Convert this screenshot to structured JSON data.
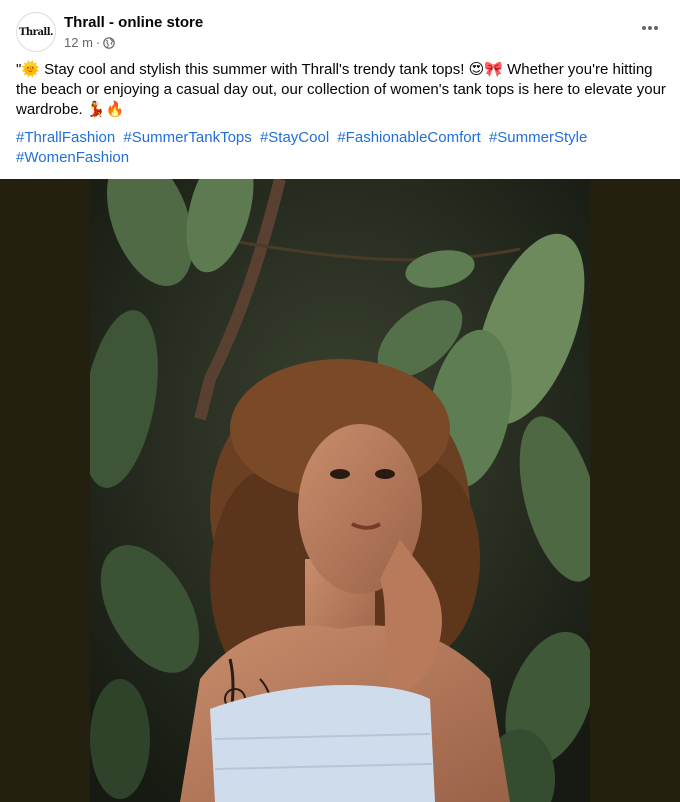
{
  "post": {
    "author": "Thrall - online store",
    "avatar_text": "Thrall.",
    "time": "12 m",
    "separator": "·",
    "audience_icon": "globe-icon",
    "more_icon": "more-horizontal-icon",
    "more_label": "•••",
    "body": "\"🌞 Stay cool and stylish this summer with Thrall's trendy tank tops! 😍🎀 Whether you're hitting the beach or enjoying a casual day out, our collection of women's tank tops is here to elevate your wardrobe. 💃🔥",
    "hashtags": [
      "#ThrallFashion",
      "#SummerTankTops",
      "#StayCool",
      "#FashionableComfort",
      "#SummerStyle",
      "#WomenFashion"
    ]
  },
  "colors": {
    "hashtag": "#216fdb",
    "meta": "#65676b",
    "media_background": "#24200f"
  }
}
